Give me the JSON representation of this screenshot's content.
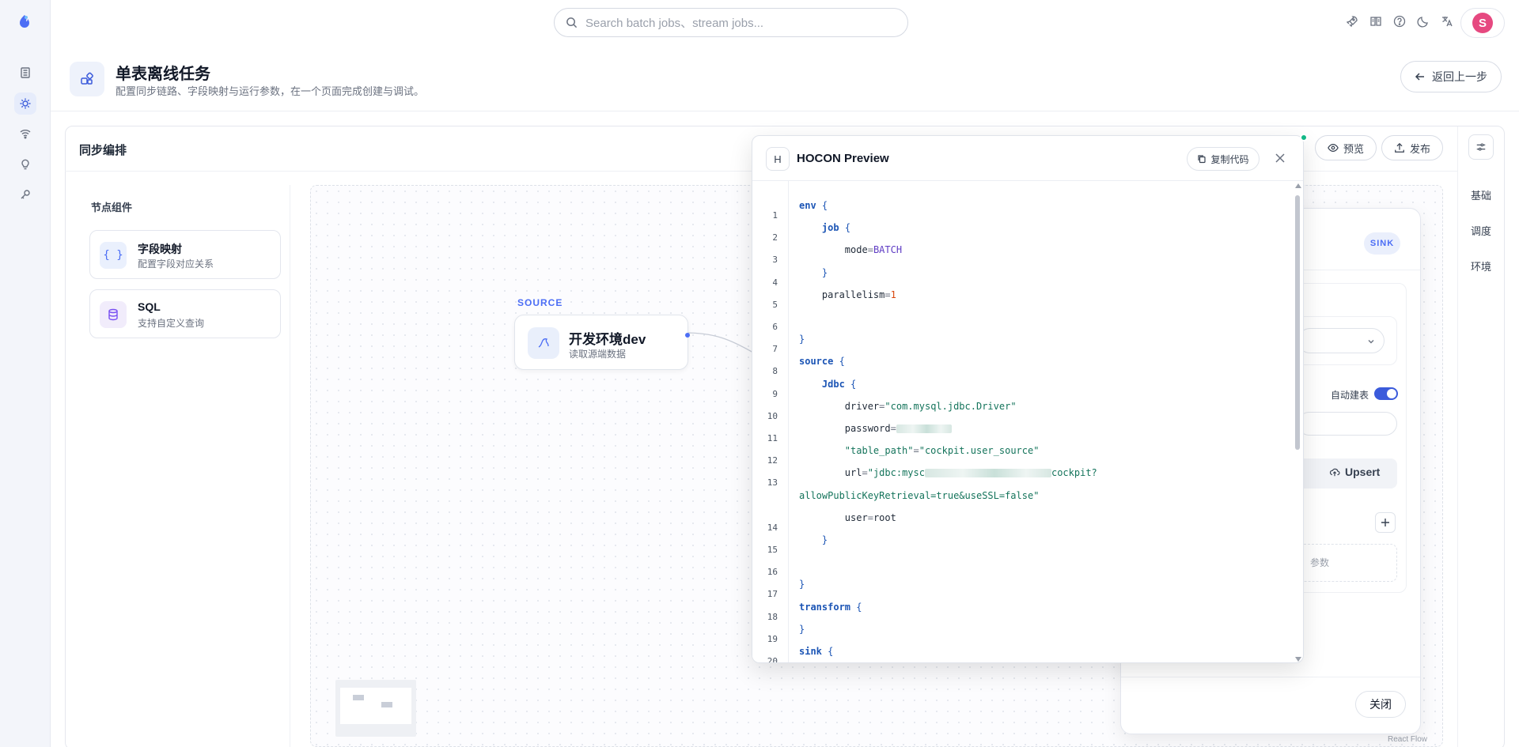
{
  "rail": {
    "items": [
      {
        "icon": "file-list-icon"
      },
      {
        "icon": "bug-icon",
        "active": true
      },
      {
        "icon": "wifi-icon"
      },
      {
        "icon": "lightbulb-icon"
      },
      {
        "icon": "key-icon"
      }
    ]
  },
  "topbar": {
    "search_placeholder": "Search batch jobs、stream jobs...",
    "avatar_letter": "S",
    "icons": [
      "rocket-icon",
      "book-icon",
      "help-icon",
      "moon-icon",
      "translate-icon"
    ]
  },
  "page": {
    "title": "单表离线任务",
    "subtitle": "配置同步链路、字段映射与运行参数，在一个页面完成创建与调试。",
    "back_label": "返回上一步"
  },
  "card": {
    "title": "同步编排",
    "preview_label": "预览",
    "publish_label": "发布",
    "side_tabs": [
      "基础",
      "调度",
      "环境"
    ]
  },
  "components": {
    "title": "节点组件",
    "items": [
      {
        "icon_text": "{ }",
        "title": "字段映射",
        "subtitle": "配置字段对应关系"
      },
      {
        "icon_text": "",
        "title": "SQL",
        "subtitle": "支持自定义查询"
      }
    ]
  },
  "canvas": {
    "source_tag": "SOURCE",
    "node_title": "开发环境dev",
    "node_subtitle": "读取源端数据",
    "react_flow_label": "React Flow"
  },
  "drawer": {
    "sink_badge": "SINK",
    "auto_create_label": "自动建表",
    "auto_create_on": true,
    "upsert_label": "Upsert",
    "dashed_text": "参数",
    "close_label": "关闭"
  },
  "modal": {
    "badge": "H",
    "title": "HOCON Preview",
    "copy_label": "复制代码",
    "lines": [
      {
        "n": "1",
        "parts": [
          [
            "kw",
            "env"
          ],
          [
            "br",
            " {"
          ]
        ]
      },
      {
        "n": "2",
        "parts": [
          [
            "",
            "    "
          ],
          [
            "kw",
            "job"
          ],
          [
            "br",
            " {"
          ]
        ]
      },
      {
        "n": "3",
        "parts": [
          [
            "",
            "        mode"
          ],
          [
            "eq",
            "="
          ],
          [
            "val",
            "BATCH"
          ]
        ]
      },
      {
        "n": "4",
        "parts": [
          [
            "br",
            "    }"
          ]
        ]
      },
      {
        "n": "5",
        "parts": [
          [
            "",
            "    parallelism"
          ],
          [
            "eq",
            "="
          ],
          [
            "num",
            "1"
          ]
        ]
      },
      {
        "n": "6",
        "parts": [
          [
            "",
            ""
          ]
        ]
      },
      {
        "n": "7",
        "parts": [
          [
            "br",
            "}"
          ]
        ]
      },
      {
        "n": "8",
        "parts": [
          [
            "kw",
            "source"
          ],
          [
            "br",
            " {"
          ]
        ]
      },
      {
        "n": "9",
        "parts": [
          [
            "",
            "    "
          ],
          [
            "kw",
            "Jdbc"
          ],
          [
            "br",
            " {"
          ]
        ]
      },
      {
        "n": "10",
        "parts": [
          [
            "",
            "        driver"
          ],
          [
            "eq",
            "="
          ],
          [
            "str",
            "\"com.mysql.jdbc.Driver\""
          ]
        ]
      },
      {
        "n": "11",
        "parts": [
          [
            "",
            "        password"
          ],
          [
            "eq",
            "="
          ],
          [
            "blur",
            "70"
          ]
        ]
      },
      {
        "n": "12",
        "parts": [
          [
            "",
            "        "
          ],
          [
            "str",
            "\"table_path\""
          ],
          [
            "eq",
            "="
          ],
          [
            "str",
            "\"cockpit.user_source\""
          ]
        ]
      },
      {
        "n": "13",
        "parts": [
          [
            "",
            "        url"
          ],
          [
            "eq",
            "="
          ],
          [
            "str",
            "\"jdbc:mysc"
          ],
          [
            "blur",
            "160"
          ],
          [
            "str",
            "cockpit?"
          ]
        ]
      },
      {
        "n": "",
        "parts": [
          [
            "str",
            "allowPublicKeyRetrieval=true&useSSL=false\""
          ]
        ]
      },
      {
        "n": "14",
        "parts": [
          [
            "",
            "        user"
          ],
          [
            "eq",
            "="
          ],
          [
            "",
            "root"
          ]
        ]
      },
      {
        "n": "15",
        "parts": [
          [
            "br",
            "    }"
          ]
        ]
      },
      {
        "n": "16",
        "parts": [
          [
            "",
            ""
          ]
        ]
      },
      {
        "n": "17",
        "parts": [
          [
            "br",
            "}"
          ]
        ]
      },
      {
        "n": "18",
        "parts": [
          [
            "kw",
            "transform"
          ],
          [
            "br",
            " {"
          ]
        ]
      },
      {
        "n": "19",
        "parts": [
          [
            "br",
            "}"
          ]
        ]
      },
      {
        "n": "20",
        "parts": [
          [
            "kw",
            "sink"
          ],
          [
            "br",
            " {"
          ]
        ]
      }
    ]
  },
  "colors": {
    "accent": "#3b5bdb",
    "avatar": "#e64980",
    "status_dot": "#12b886"
  }
}
